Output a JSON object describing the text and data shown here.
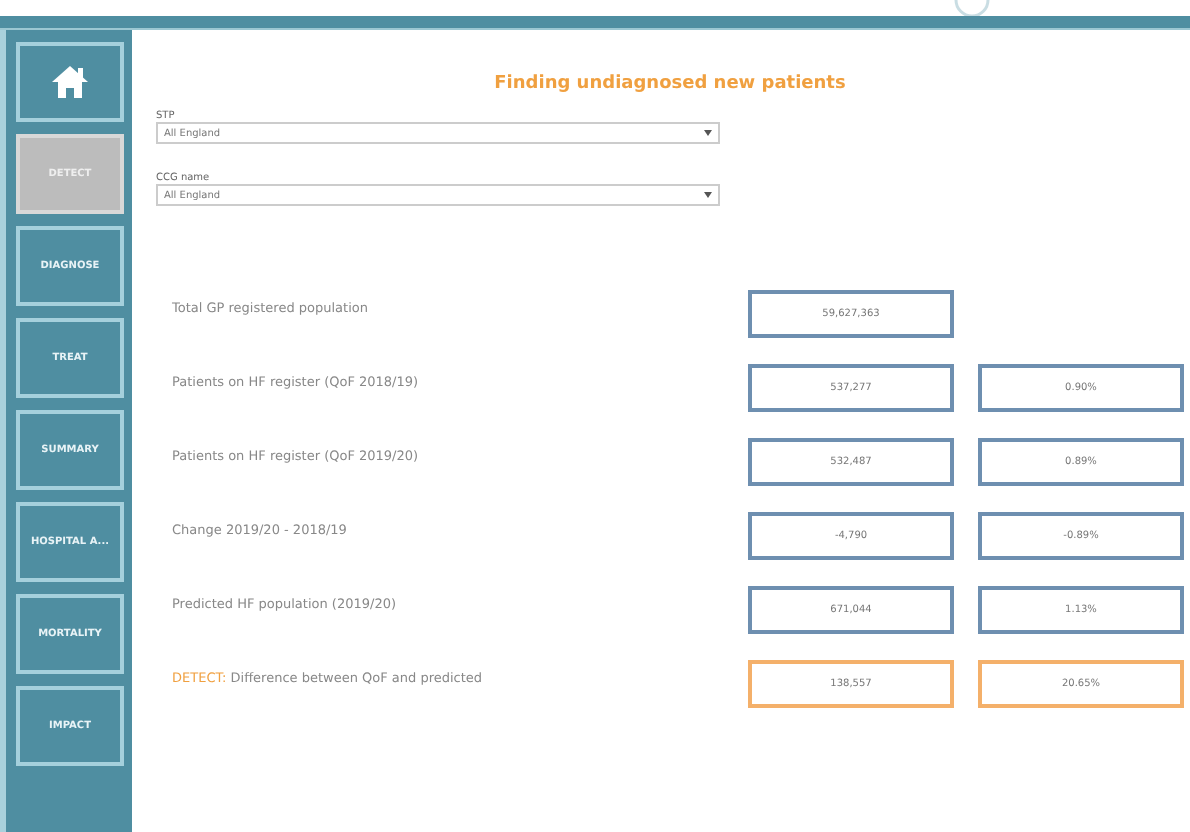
{
  "sidebar": {
    "items": [
      {
        "kind": "home",
        "selected": false
      },
      {
        "kind": "text",
        "label": "DETECT",
        "selected": true
      },
      {
        "kind": "text",
        "label": "DIAGNOSE",
        "selected": false
      },
      {
        "kind": "text",
        "label": "TREAT",
        "selected": false
      },
      {
        "kind": "text",
        "label": "SUMMARY",
        "selected": false
      },
      {
        "kind": "text",
        "label": "HOSPITAL A...",
        "selected": false
      },
      {
        "kind": "text",
        "label": "MORTALITY",
        "selected": false
      },
      {
        "kind": "text",
        "label": "IMPACT",
        "selected": false
      }
    ]
  },
  "title": "Finding undiagnosed new patients",
  "filters": [
    {
      "label": "STP",
      "value": "All England"
    },
    {
      "label": "CCG name",
      "value": "All England"
    }
  ],
  "metrics": [
    {
      "kind": "normal",
      "label": "Total GP registered population",
      "values": [
        "59,627,363"
      ]
    },
    {
      "kind": "normal",
      "label": "Patients on HF register (QoF 2018/19)",
      "values": [
        "537,277",
        "0.90%"
      ]
    },
    {
      "kind": "normal",
      "label": "Patients on HF register (QoF 2019/20)",
      "values": [
        "532,487",
        "0.89%"
      ]
    },
    {
      "kind": "normal",
      "label": "Change 2019/20 - 2018/19",
      "values": [
        "-4,790",
        "-0.89%"
      ]
    },
    {
      "kind": "normal",
      "label": "Predicted HF population (2019/20)",
      "values": [
        "671,044",
        "1.13%"
      ]
    },
    {
      "kind": "highlight",
      "prefix": "DETECT:",
      "label": "Difference between QoF and predicted",
      "values": [
        "138,557",
        "20.65%"
      ]
    }
  ]
}
